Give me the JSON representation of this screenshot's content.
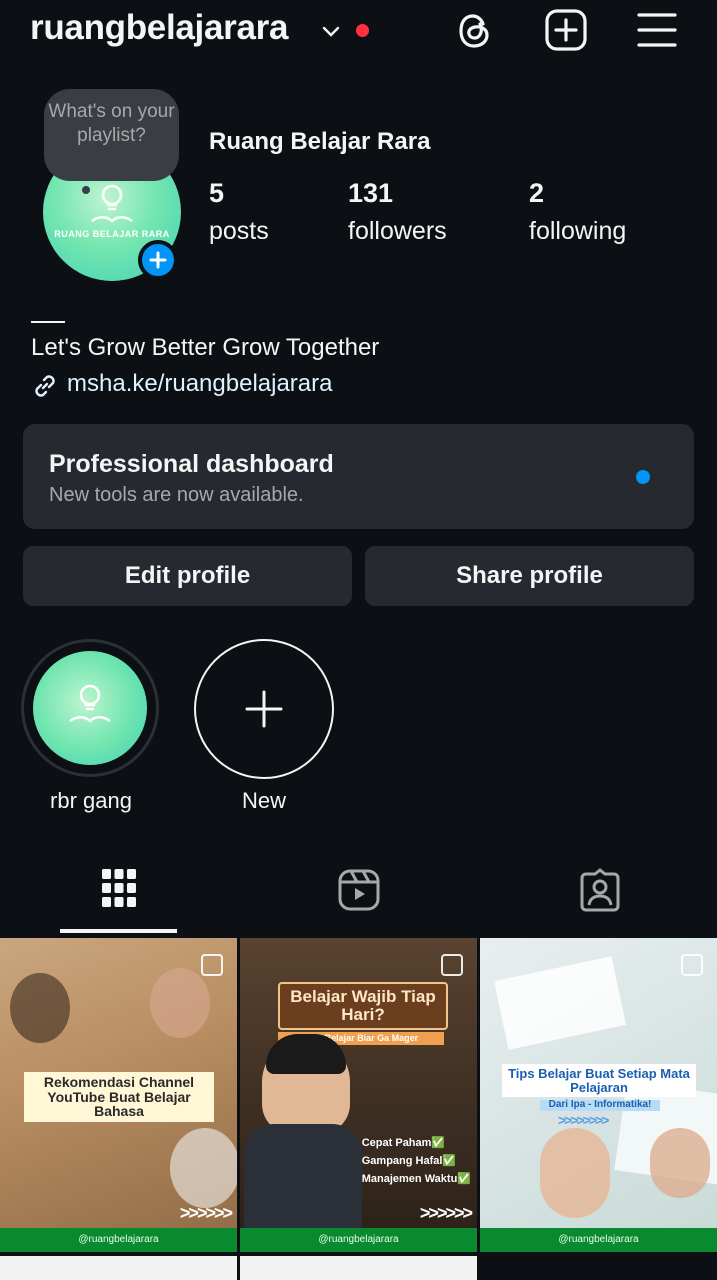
{
  "header": {
    "username": "ruangbelajarara"
  },
  "profile": {
    "note": "What's on your playlist?",
    "avatar_text": "RUANG BELAJAR RARA",
    "display_name": "Ruang Belajar Rara",
    "stats": [
      {
        "value": "5",
        "label": "posts"
      },
      {
        "value": "131",
        "label": "followers"
      },
      {
        "value": "2",
        "label": "following"
      }
    ],
    "bio": "Let's Grow Better Grow Together",
    "link": "msha.ke/ruangbelajarara"
  },
  "dashboard": {
    "title": "Professional dashboard",
    "subtitle": "New tools are now available."
  },
  "buttons": {
    "edit": "Edit profile",
    "share": "Share profile"
  },
  "highlights": [
    {
      "label": "rbr gang"
    },
    {
      "label": "New"
    }
  ],
  "posts": [
    {
      "title": "Rekomendasi Channel YouTube Buat Belajar Bahasa",
      "arrows": ">>>>>>",
      "handle": "@ruangbelajarara"
    },
    {
      "title": "Belajar Wajib Tiap Hari?",
      "subtitle": "Tips Belajar Biar Ga Mager",
      "points": [
        "Cepat Paham✅",
        "Gampang Hafal✅",
        "Manajemen Waktu✅"
      ],
      "arrows": ">>>>>>",
      "handle": "@ruangbelajarara"
    },
    {
      "title": "Tips Belajar Buat Setiap Mata Pelajaran",
      "subtitle": "Dari Ipa - Informatika!",
      "arrows": ">>>>>>>>",
      "handle": "@ruangbelajarara"
    }
  ],
  "colors": {
    "background": "#0c1014",
    "accent": "#0095f6",
    "card": "#262a30",
    "notification": "#ff3040"
  }
}
